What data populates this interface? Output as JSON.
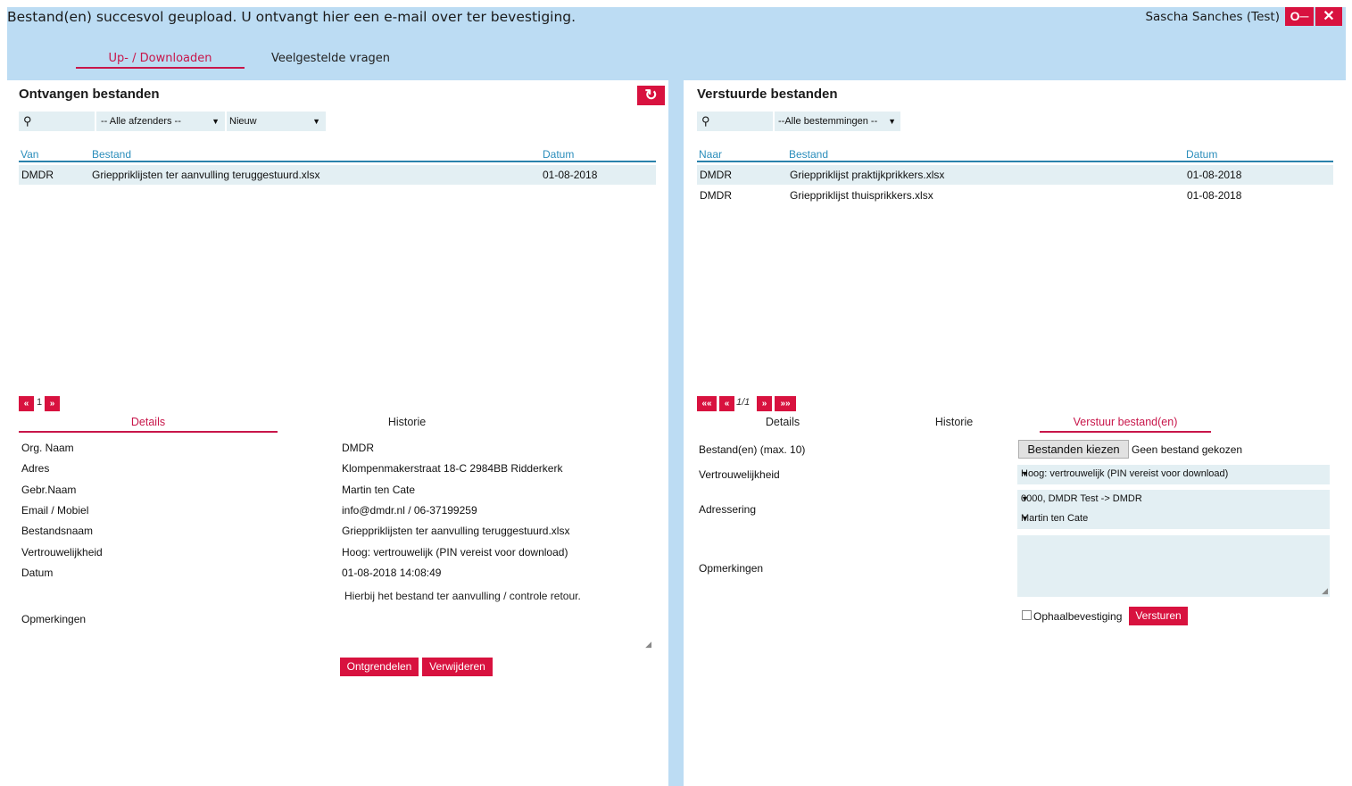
{
  "header": {
    "message": "Bestand(en) succesvol geupload. U ontvangt hier een e-mail over ter bevestiging.",
    "user": "Sascha Sanches (Test)",
    "key_label": "O─",
    "close_label": "✕",
    "tabs": [
      {
        "label": "Up- / Downloaden",
        "active": true
      },
      {
        "label": "Veelgestelde vragen",
        "active": false
      }
    ]
  },
  "received": {
    "title": "Ontvangen bestanden",
    "refresh_icon": "↻",
    "search_icon": "⚲",
    "sender_filter": "-- Alle afzenders --",
    "status_filter": "Nieuw",
    "columns": [
      "Van",
      "Bestand",
      "Datum"
    ],
    "rows": [
      {
        "from": "DMDR",
        "file": "Grieppriklijsten ter aanvulling teruggestuurd.xlsx",
        "date": "01-08-2018"
      }
    ],
    "pager": {
      "prev": "«",
      "page": "1",
      "next": "»"
    }
  },
  "details": {
    "tabs": [
      {
        "label": "Details",
        "active": true
      },
      {
        "label": "Historie",
        "active": false
      }
    ],
    "fields": [
      {
        "label": "Org. Naam",
        "value": "DMDR"
      },
      {
        "label": "Adres",
        "value": "Klompenmakerstraat 18-C 2984BB Ridderkerk"
      },
      {
        "label": "Gebr.Naam",
        "value": "Martin ten Cate"
      },
      {
        "label": "Email / Mobiel",
        "value": "info@dmdr.nl / 06-37199259"
      },
      {
        "label": "Bestandsnaam",
        "value": "Grieppriklijsten ter aanvulling teruggestuurd.xlsx"
      },
      {
        "label": "Vertrouwelijkheid",
        "value": "Hoog: vertrouwelijk (PIN vereist voor download)"
      },
      {
        "label": "Datum",
        "value": "01-08-2018 14:08:49"
      }
    ],
    "remarks_label": "Opmerkingen",
    "remarks_value": "Hierbij het bestand ter aanvulling / controle retour.",
    "unlock_label": "Ontgrendelen",
    "delete_label": "Verwijderen"
  },
  "sent": {
    "title": "Verstuurde bestanden",
    "search_icon": "⚲",
    "dest_filter": "--Alle bestemmingen --",
    "columns": [
      "Naar",
      "Bestand",
      "Datum"
    ],
    "rows": [
      {
        "to": "DMDR",
        "file": "Grieppriklijst praktijkprikkers.xlsx",
        "date": "01-08-2018"
      },
      {
        "to": "DMDR",
        "file": "Grieppriklijst thuisprikkers.xlsx",
        "date": "01-08-2018"
      }
    ],
    "pager": {
      "first": "««",
      "prev": "«",
      "page": "1/1",
      "next": "»",
      "last": "»»"
    }
  },
  "send": {
    "tabs": [
      {
        "label": "Details",
        "active": false
      },
      {
        "label": "Historie",
        "active": false
      },
      {
        "label": "Verstuur bestand(en)",
        "active": true
      }
    ],
    "files_label": "Bestand(en) (max. 10)",
    "choose_button": "Bestanden kiezen",
    "no_file": "Geen bestand gekozen",
    "confidentiality_label": "Vertrouwelijkheid",
    "confidentiality_value": "Hoog: vertrouwelijk (PIN vereist voor download)",
    "addressing_label": "Adressering",
    "address_org": "0000, DMDR Test -> DMDR",
    "address_person": "Martin ten Cate",
    "remarks_label": "Opmerkingen",
    "pickup_label": "Ophaalbevestiging",
    "send_button": "Versturen"
  },
  "colors": {
    "accent": "#d8123f",
    "header_bg": "#bcdcf3",
    "field_bg": "#e3eff3",
    "column_header": "#2a8dbb"
  }
}
